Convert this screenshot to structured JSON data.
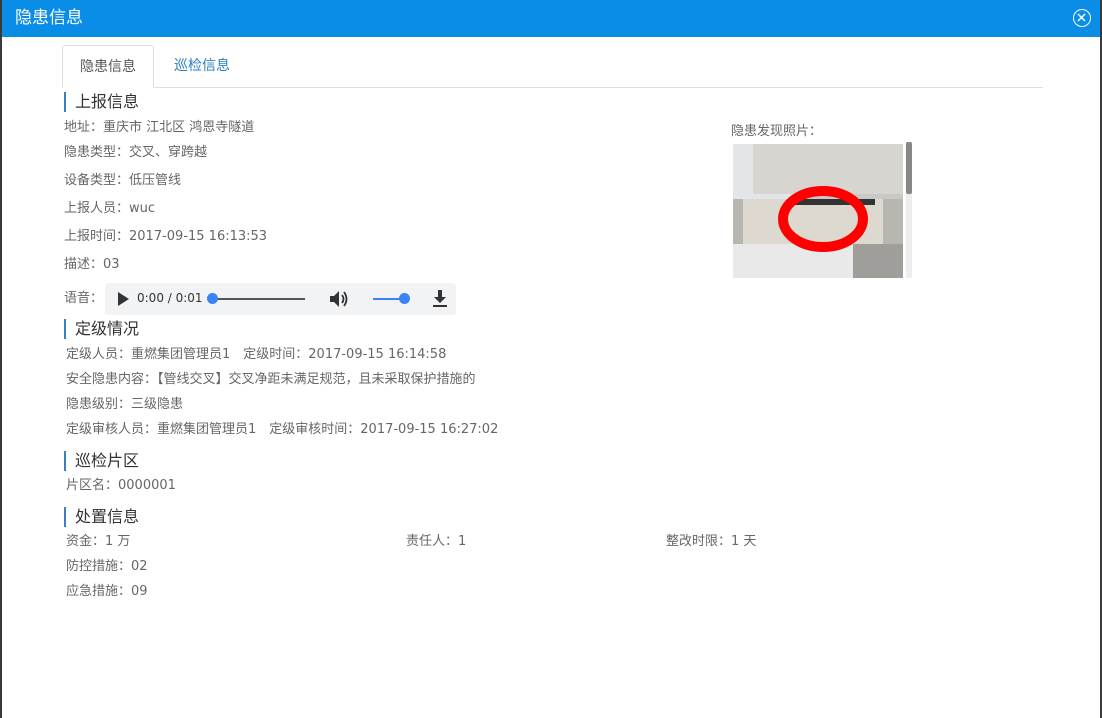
{
  "window": {
    "title": "隐患信息",
    "close_icon": "close-circle-icon"
  },
  "tabs": [
    {
      "label": "隐患信息",
      "active": true
    },
    {
      "label": "巡检信息",
      "active": false
    }
  ],
  "report": {
    "title": "上报信息",
    "address": "地址：重庆市 江北区 鸿恩寺隧道",
    "hazard_type": "隐患类型：交叉、穿跨越",
    "device_type": "设备类型：低压管线",
    "reporter": "上报人员：wuc",
    "report_time": "上报时间：2017-09-15 16:13:53",
    "description": "描述：03",
    "voice_label": "语音：",
    "photo_label": "隐患发现照片："
  },
  "audio_player": {
    "time": "0:00 / 0:01",
    "progress": 0,
    "volume": 1,
    "icons": [
      "play-icon",
      "volume-icon",
      "download-icon"
    ]
  },
  "grading": {
    "title": "定级情况",
    "grader_line": "定级人员：重燃集团管理员1　定级时间：2017-09-15 16:14:58",
    "content": "安全隐患内容：【管线交叉】交叉净距未满足规范，且未采取保护措施的",
    "level": "隐患级别：三级隐患",
    "review_line": "定级审核人员：重燃集团管理员1　定级审核时间：2017-09-15 16:27:02"
  },
  "patrol_area": {
    "title": "巡检片区",
    "name": "片区名：0000001"
  },
  "disposal": {
    "title": "处置信息",
    "funds": "资金：1 万",
    "responsible": "责任人：1",
    "deadline": "整改时限：1 天",
    "prevention": "防控措施：02",
    "emergency": "应急措施：09"
  },
  "colors": {
    "titlebar": "#0a8de6",
    "accent": "#3a7fc2",
    "link": "#2a7fc0"
  }
}
